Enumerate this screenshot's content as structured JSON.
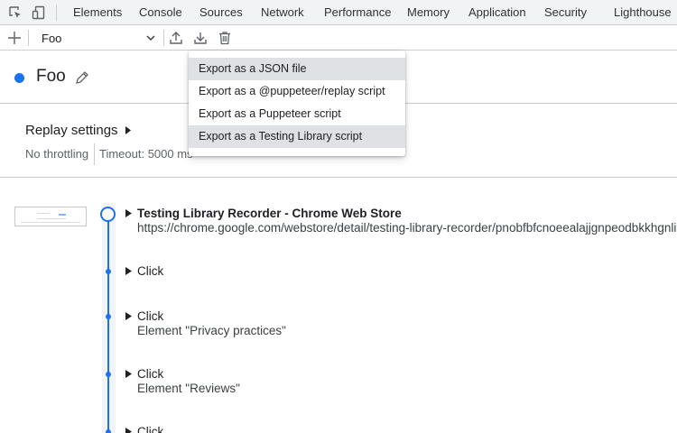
{
  "devtools": {
    "tabs": [
      "Elements",
      "Console",
      "Sources",
      "Network",
      "Performance",
      "Memory",
      "Application",
      "Security",
      "Lighthouse"
    ]
  },
  "toolbar": {
    "recording_selected": "Foo"
  },
  "recording": {
    "title": "Foo",
    "accent_color": "#1a73e8"
  },
  "replay_settings": {
    "title": "Replay settings",
    "throttling": "No throttling",
    "timeout": "Timeout: 5000 ms"
  },
  "export_menu": {
    "items": [
      "Export as a JSON file",
      "Export as a @puppeteer/replay script",
      "Export as a Puppeteer script",
      "Export as a Testing Library script"
    ],
    "highlighted": [
      "Export as a JSON file",
      "Export as a Testing Library script"
    ]
  },
  "steps": [
    {
      "title": "Testing Library Recorder - Chrome Web Store",
      "subtitle": "https://chrome.google.com/webstore/detail/testing-library-recorder/pnobfbfcnoeealajjgnpeodbkkhgnlie"
    },
    {
      "title": "Click",
      "subtitle": ""
    },
    {
      "title": "Click",
      "subtitle": "Element \"Privacy practices\""
    },
    {
      "title": "Click",
      "subtitle": "Element \"Reviews\""
    },
    {
      "title": "Click",
      "subtitle": ""
    }
  ]
}
